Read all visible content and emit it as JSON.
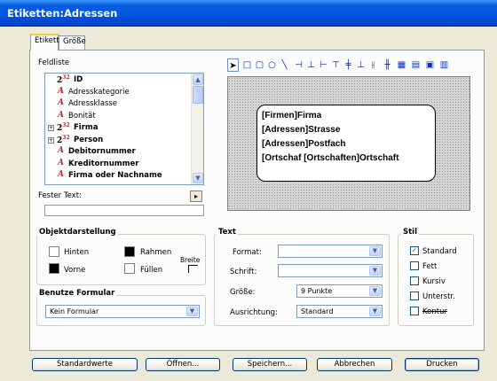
{
  "window": {
    "title": "Etiketten:Adressen"
  },
  "tabs": [
    {
      "label": "Etikett"
    },
    {
      "label": "Größe"
    }
  ],
  "fieldlist": {
    "label": "Feldliste",
    "items": [
      {
        "label": "ID",
        "kind": "number",
        "bold": true,
        "expandable": false
      },
      {
        "label": "Adresskategorie",
        "kind": "text",
        "bold": false,
        "expandable": false
      },
      {
        "label": "Adressklasse",
        "kind": "text",
        "bold": false,
        "expandable": false
      },
      {
        "label": "Bonität",
        "kind": "text",
        "bold": false,
        "expandable": false
      },
      {
        "label": "Firma",
        "kind": "number",
        "bold": true,
        "expandable": true
      },
      {
        "label": "Person",
        "kind": "number",
        "bold": true,
        "expandable": true
      },
      {
        "label": "Debitornummer",
        "kind": "text",
        "bold": true,
        "expandable": false
      },
      {
        "label": "Kreditornummer",
        "kind": "text",
        "bold": true,
        "expandable": false
      },
      {
        "label": "Firma oder Nachname",
        "kind": "text",
        "bold": true,
        "expandable": false
      }
    ],
    "number_icon": "2",
    "number_sup": "32",
    "text_icon": "A",
    "expand_glyph": "+"
  },
  "fixed_text": {
    "label": "Fester Text:",
    "value": ""
  },
  "label_lines": [
    "[Firmen]Firma",
    "[Adressen]Strasse",
    "[Adressen]Postfach",
    "[Ortschaf [Ortschaften]Ortschaft"
  ],
  "objektdarstellung": {
    "title": "Objektdarstellung",
    "hinten": "Hinten",
    "rahmen": "Rahmen",
    "vorne": "Vorne",
    "fuellen": "Füllen",
    "breite": "Breite"
  },
  "benutze_formular": {
    "title": "Benutze Formular",
    "value": "Kein Formular"
  },
  "text_group": {
    "title": "Text",
    "format_label": "Format:",
    "format_value": "",
    "schrift_label": "Schrift:",
    "schrift_value": "",
    "groesse_label": "Größe:",
    "groesse_value": "9 Punkte",
    "ausrichtung_label": "Ausrichtung:",
    "ausrichtung_value": "Standard"
  },
  "stil": {
    "title": "Stil",
    "options": [
      {
        "label": "Standard",
        "checked": true
      },
      {
        "label": "Fett",
        "checked": false
      },
      {
        "label": "Kursiv",
        "checked": false
      },
      {
        "label": "Unterstr.",
        "checked": false
      },
      {
        "label": "Kontur",
        "checked": false
      }
    ]
  },
  "buttons": {
    "standardwerte": "Standardwerte",
    "oeffnen": "Öffnen...",
    "speichern": "Speichern...",
    "abbrechen": "Abbrechen",
    "drucken": "Drucken"
  },
  "colors": {
    "titlebar": "#0054e3",
    "accent_tab": "#ffc83c",
    "canvas": "#d4d4d4"
  }
}
